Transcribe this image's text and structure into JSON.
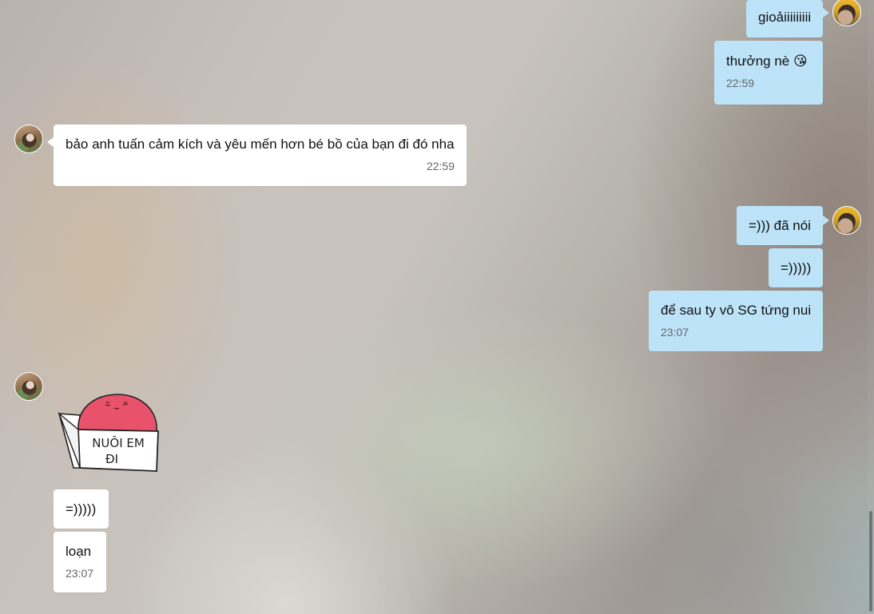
{
  "chat": {
    "messages": [
      {
        "sender": "me",
        "text": "gioảiiiiiiiii",
        "time": ""
      },
      {
        "sender": "me",
        "text": "thưởng nè 😘",
        "time": "22:59"
      },
      {
        "sender": "them",
        "text": "bảo anh tuấn cảm kích và yêu mến hơn bé bồ của bạn đi đó nha",
        "time": "22:59"
      },
      {
        "sender": "me",
        "text": "=))) đã nói",
        "time": ""
      },
      {
        "sender": "me",
        "text": "=)))))",
        "time": ""
      },
      {
        "sender": "me",
        "text": "để sau ty vô SG tứng nui",
        "time": "23:07"
      },
      {
        "sender": "them",
        "sticker": "nuoi-em-di-sticker",
        "sticker_text": [
          "NUÔI EM",
          "ĐI"
        ],
        "time": ""
      },
      {
        "sender": "them",
        "text": "=)))))",
        "time": ""
      },
      {
        "sender": "them",
        "text": "loạn",
        "time": "23:07"
      }
    ]
  },
  "colors": {
    "my_bubble": "#bde3f8",
    "their_bubble": "#ffffff",
    "sticker_red": "#e8526a",
    "time_text": "#666666"
  },
  "icons": {
    "my_avatar": "user-avatar-me",
    "their_avatar": "user-avatar-contact"
  }
}
